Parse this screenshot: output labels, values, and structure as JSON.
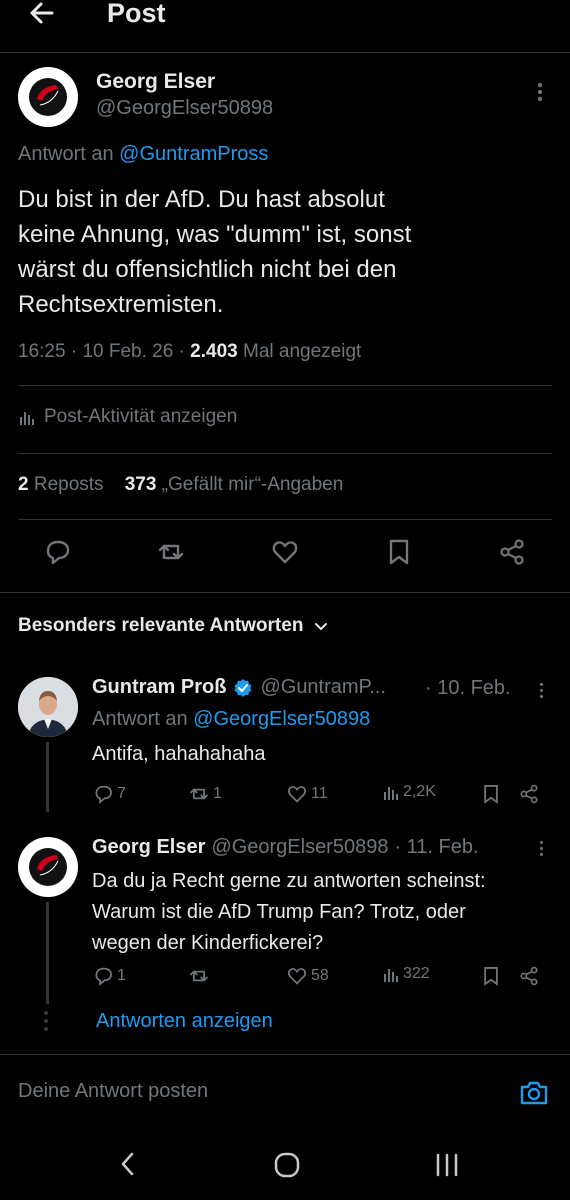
{
  "header": {
    "title": "Post"
  },
  "post": {
    "author_name": "Georg Elser",
    "author_handle": "@GeorgElser50898",
    "reply_prefix": "Antwort an",
    "reply_handle": "@GuntramPross",
    "text_lines": [
      "Du bist in der AfD. Du hast absolut",
      "keine Ahnung, was \"dumm\" ist, sonst",
      "wärst du offensichtlich nicht bei den",
      "Rechtsextremisten."
    ],
    "time": "16:25",
    "date": "10 Feb. 26",
    "views": "2.403",
    "views_label": "Mal angezeigt",
    "activity_label": "Post-Aktivität anzeigen",
    "reposts": "2",
    "reposts_label": "Reposts",
    "likes": "373",
    "likes_label": "„Gefällt mir“-Angaben",
    "avatar_text_top": "ANTIFASCIST",
    "avatar_text_bottom": "ACTION"
  },
  "section": {
    "title": "Besonders relevante Antworten"
  },
  "replies": [
    {
      "name": "Guntram Proß",
      "handle": "@GuntramP...",
      "date": "· 10. Feb.",
      "reply_prefix": "Antwort an",
      "reply_handle": "@GeorgElser50898",
      "text_lines": [
        "Antifa, hahahahaha"
      ],
      "replies": "7",
      "reposts": "1",
      "likes": "11",
      "views": "2,2K",
      "verified": true
    },
    {
      "name": "Georg Elser",
      "handle": "@GeorgElser50898",
      "date": "· 11. Feb.",
      "text_lines": [
        "Da du ja Recht gerne zu antworten scheinst:",
        "Warum ist die AfD Trump Fan? Trotz, oder",
        "wegen der Kinderfickerei?"
      ],
      "replies": "1",
      "reposts": "",
      "likes": "58",
      "views": "322"
    }
  ],
  "show_replies_label": "Antworten anzeigen",
  "reply_box": {
    "placeholder": "Deine Antwort posten"
  },
  "colors": {
    "accent": "#1d9bf0",
    "background": "#000000",
    "text": "#e7e9ea",
    "muted": "#71767b",
    "antifa_red": "#d0021b"
  }
}
